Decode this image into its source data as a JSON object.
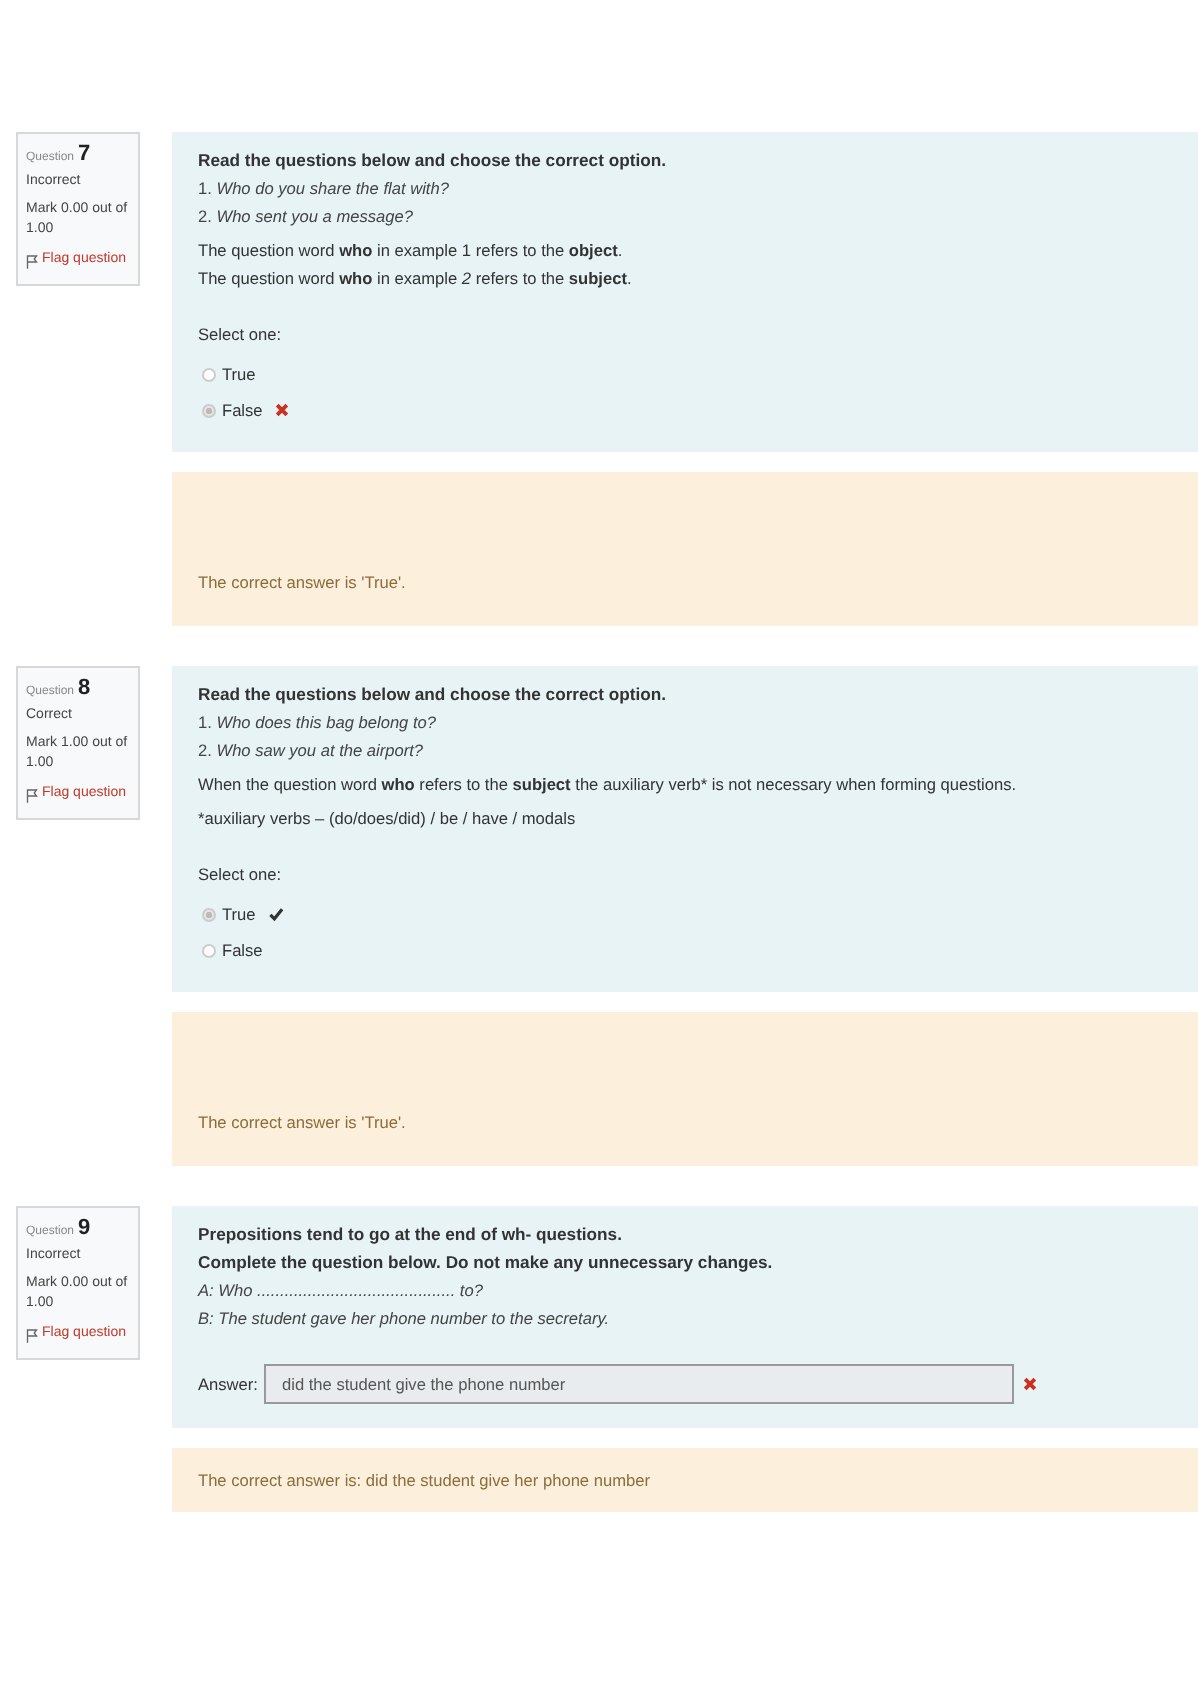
{
  "questions": [
    {
      "label": "Question",
      "number": "7",
      "status": "Incorrect",
      "mark": "Mark 0.00 out of 1.00",
      "flag": "Flag question",
      "kind": "multichoice",
      "paragraphs": [
        {
          "kind": "heading",
          "text": "Read the questions below and choose the correct option."
        },
        {
          "kind": "example",
          "text": "1. *Who do you share the flat with?*"
        },
        {
          "kind": "example",
          "text": "2. *Who sent you a message?*"
        },
        {
          "kind": "note",
          "text": "The question word **who** in example 1 refers to the **object**."
        },
        {
          "kind": "note-tight",
          "text": "The question word **who** in example *2* refers to the **subject**."
        }
      ],
      "prompt": "Select one:",
      "options": [
        {
          "label": "True",
          "selected": false,
          "correct_mark": false,
          "incorrect_mark": false
        },
        {
          "label": "False",
          "selected": true,
          "correct_mark": false,
          "incorrect_mark": true
        }
      ],
      "feedback": "The correct answer is 'True'."
    },
    {
      "label": "Question",
      "number": "8",
      "status": "Correct",
      "mark": "Mark 1.00 out of 1.00",
      "flag": "Flag question",
      "kind": "multichoice",
      "paragraphs": [
        {
          "kind": "heading",
          "text": "Read the questions below and choose the correct option."
        },
        {
          "kind": "example",
          "text": "1. *Who does this bag belong to?*"
        },
        {
          "kind": "example",
          "text": "2. *Who saw you at the airport?*"
        },
        {
          "kind": "note",
          "text": "When the question word **who** refers to the **subject** the auxiliary verb* is not necessary when forming questions."
        },
        {
          "kind": "note",
          "text": "*auxiliary verbs – (do/does/did) / be / have / modals"
        }
      ],
      "prompt": "Select one:",
      "options": [
        {
          "label": "True",
          "selected": true,
          "correct_mark": true,
          "incorrect_mark": false
        },
        {
          "label": "False",
          "selected": false,
          "correct_mark": false,
          "incorrect_mark": false
        }
      ],
      "feedback": "The correct answer is 'True'."
    },
    {
      "label": "Question",
      "number": "9",
      "status": "Incorrect",
      "mark": "Mark 0.00 out of 1.00",
      "flag": "Flag question",
      "kind": "shortanswer",
      "paragraphs": [
        {
          "kind": "heading",
          "text": "Prepositions tend to go at the end of wh- questions."
        },
        {
          "kind": "heading-tight",
          "text": "Complete the question below. Do not make any unnecessary changes."
        },
        {
          "kind": "example",
          "text": "*A: Who ........................................... to?*"
        },
        {
          "kind": "example",
          "text": "*B: The student gave her phone number to the secretary.*"
        }
      ],
      "answer": {
        "label": "Answer:",
        "value": "did the student give the phone number",
        "correct_mark": false,
        "incorrect_mark": true
      },
      "feedback": "The correct answer is: did the student give her phone number"
    }
  ]
}
